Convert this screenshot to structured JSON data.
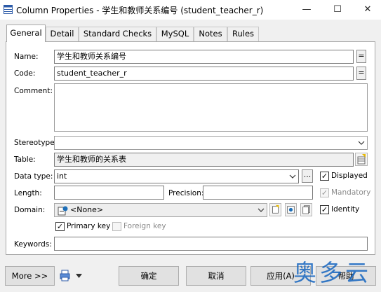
{
  "window": {
    "title": "Column Properties - 学生和教师关系编号 (student_teacher_r)",
    "minimize": "—",
    "maximize": "☐",
    "close": "✕"
  },
  "tabs": [
    "General",
    "Detail",
    "Standard Checks",
    "MySQL",
    "Notes",
    "Rules"
  ],
  "form": {
    "name_label": "Name:",
    "name_value": "学生和教师关系编号",
    "code_label": "Code:",
    "code_value": "student_teacher_r",
    "equals_symbol": "=",
    "comment_label": "Comment:",
    "comment_value": "",
    "stereotype_label": "Stereotype:",
    "stereotype_value": "",
    "table_label": "Table:",
    "table_value": "学生和教师的关系表",
    "datatype_label": "Data type:",
    "datatype_value": "int",
    "datatype_browse": "...",
    "displayed_label": "Displayed",
    "displayed_checked": true,
    "length_label": "Length:",
    "length_value": "",
    "precision_label": "Precision:",
    "precision_value": "",
    "mandatory_label": "Mandatory",
    "mandatory_checked": true,
    "domain_label": "Domain:",
    "domain_value": "<None>",
    "identity_label": "Identity",
    "identity_checked": true,
    "primarykey_label": "Primary key",
    "primarykey_checked": true,
    "foreignkey_label": "Foreign key",
    "foreignkey_checked": false,
    "keywords_label": "Keywords:",
    "keywords_value": ""
  },
  "footer": {
    "more_label": "More >>",
    "ok_label": "确定",
    "cancel_label": "取消",
    "apply_label": "应用(A)",
    "help_label": "帮助"
  },
  "watermark": "奥多云",
  "check_mark": "✓",
  "colors": {
    "accent": "#1e6fb8",
    "watermark": "#1565c0"
  }
}
